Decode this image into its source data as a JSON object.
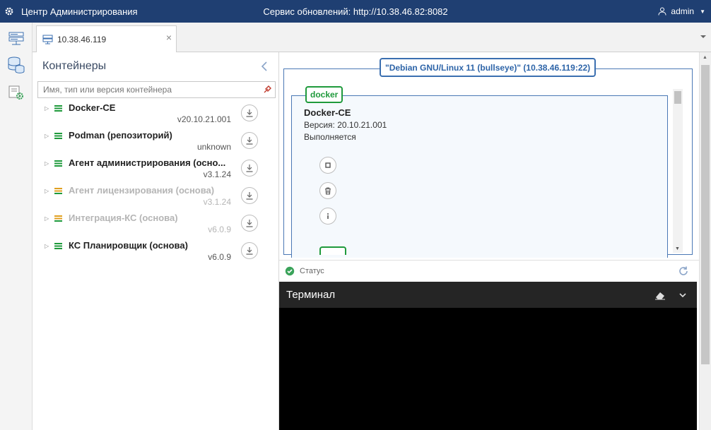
{
  "topbar": {
    "app_title": "Центр Администрирования",
    "update_service": "Сервис обновлений: http://10.38.46.82:8082",
    "user": "admin"
  },
  "tab": {
    "label": "10.38.46.119"
  },
  "containers_panel": {
    "title": "Контейнеры",
    "search_placeholder": "Имя, тип или версия контейнера",
    "items": [
      {
        "name": "Docker-CE",
        "version": "v20.10.21.001",
        "enabled": true
      },
      {
        "name": "Podman (репозиторий)",
        "version": "unknown",
        "enabled": true
      },
      {
        "name": "Агент администрирования (осно...",
        "version": "v3.1.24",
        "enabled": true
      },
      {
        "name": "Агент лицензирования (основа)",
        "version": "v3.1.24",
        "enabled": false
      },
      {
        "name": "Интеграция-КС (основа)",
        "version": "v6.0.9",
        "enabled": false
      },
      {
        "name": "КС Планировщик (основа)",
        "version": "v6.0.9",
        "enabled": true
      }
    ]
  },
  "host": {
    "label": "\"Debian GNU/Linux 11 (bullseye)\" (10.38.46.119:22)",
    "container": {
      "badge": "docker",
      "name": "Docker-CE",
      "version": "Версия: 20.10.21.001",
      "state": "Выполняется"
    }
  },
  "status": {
    "label": "Статус"
  },
  "terminal": {
    "title": "Терминал"
  },
  "colors": {
    "topbar": "#1f3f72",
    "accent": "#2d64a8",
    "green": "#1f9a3c",
    "terminal": "#000000"
  }
}
